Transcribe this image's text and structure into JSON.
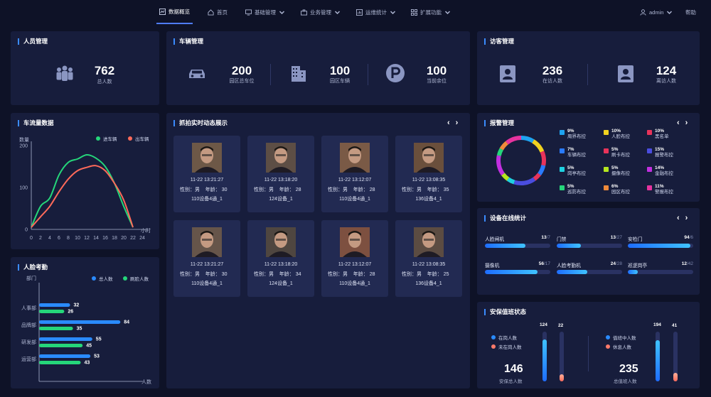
{
  "nav": {
    "items": [
      {
        "label": "数据概览",
        "active": true,
        "icon": "chart-icon"
      },
      {
        "label": "首页",
        "icon": "home-icon"
      },
      {
        "label": "基础管理",
        "icon": "monitor-icon",
        "dropdown": true
      },
      {
        "label": "业务管理",
        "icon": "briefcase-icon",
        "dropdown": true
      },
      {
        "label": "运维统计",
        "icon": "stats-icon",
        "dropdown": true
      },
      {
        "label": "扩展功能",
        "icon": "apps-icon",
        "dropdown": true
      }
    ],
    "user": "admin",
    "help": "帮助"
  },
  "personnel": {
    "title": "人员管理",
    "value": "762",
    "label": "总人数"
  },
  "vehicles": {
    "title": "车辆管理",
    "stats": [
      {
        "value": "200",
        "label": "园区总车位"
      },
      {
        "value": "100",
        "label": "园区车辆"
      },
      {
        "value": "100",
        "label": "当前余位"
      }
    ]
  },
  "visitors": {
    "title": "访客管理",
    "stats": [
      {
        "value": "236",
        "label": "在访人数"
      },
      {
        "value": "124",
        "label": "离访人数"
      }
    ]
  },
  "traffic": {
    "title": "车流量数据",
    "ylabel": "数量",
    "xunit": "小时",
    "legend_in": "进车辆",
    "legend_out": "出车辆"
  },
  "attendance": {
    "title": "人脸考勤",
    "ylabel": "部门",
    "xunit": "人数",
    "legend_total": "总人数",
    "legend_face": "刷脸人数"
  },
  "snapshots": {
    "title": "抓拍实时动态展示",
    "items": [
      {
        "time": "11-22 13:21:27",
        "gender_label": "性别：",
        "gender": "男",
        "age_label": "年龄：",
        "age": "30",
        "device": "110设备4通_1"
      },
      {
        "time": "11-22 13:18:20",
        "gender_label": "性别：",
        "gender": "男",
        "age_label": "年龄：",
        "age": "28",
        "device": "124设备_1"
      },
      {
        "time": "11-22 13:12:07",
        "gender_label": "性别：",
        "gender": "男",
        "age_label": "年龄：",
        "age": "28",
        "device": "110设备4通_1"
      },
      {
        "time": "11-22 13:08:35",
        "gender_label": "性别：",
        "gender": "男",
        "age_label": "年龄：",
        "age": "35",
        "device": "136设备4_1"
      },
      {
        "time": "11-22 13:21:27",
        "gender_label": "性别：",
        "gender": "男",
        "age_label": "年龄：",
        "age": "30",
        "device": "110设备4通_1"
      },
      {
        "time": "11-22 13:18:20",
        "gender_label": "性别：",
        "gender": "男",
        "age_label": "年龄：",
        "age": "34",
        "device": "124设备_1"
      },
      {
        "time": "11-22 13:12:07",
        "gender_label": "性别：",
        "gender": "男",
        "age_label": "年龄：",
        "age": "28",
        "device": "110设备4通_1"
      },
      {
        "time": "11-22 13:08:35",
        "gender_label": "性别：",
        "gender": "男",
        "age_label": "年龄：",
        "age": "25",
        "device": "136设备4_1"
      }
    ]
  },
  "alarms": {
    "title": "报警管理",
    "items": [
      {
        "pct": "9%",
        "name": "周界布控",
        "color": "#1fa3f0"
      },
      {
        "pct": "10%",
        "name": "人脸布控",
        "color": "#f0d21f"
      },
      {
        "pct": "10%",
        "name": "黑名单",
        "color": "#e8335a"
      },
      {
        "pct": "7%",
        "name": "车辆布控",
        "color": "#2a7bff"
      },
      {
        "pct": "5%",
        "name": "刷卡布控",
        "color": "#e8335a"
      },
      {
        "pct": "15%",
        "name": "报警布控",
        "color": "#4a4ddf"
      },
      {
        "pct": "5%",
        "name": "岗亭布控",
        "color": "#1fd0e0"
      },
      {
        "pct": "5%",
        "name": "摄像布控",
        "color": "#b5e61f"
      },
      {
        "pct": "14%",
        "name": "金融布控",
        "color": "#c22fe0"
      },
      {
        "pct": "5%",
        "name": "巡防布控",
        "color": "#25d67a"
      },
      {
        "pct": "6%",
        "name": "园区布控",
        "color": "#f08a3a"
      },
      {
        "pct": "11%",
        "name": "警报布控",
        "color": "#e6339f"
      }
    ]
  },
  "devices": {
    "title": "设备在线统计",
    "items": [
      {
        "name": "人脸闸机",
        "online": "13",
        "total": "/7",
        "level": 0.62
      },
      {
        "name": "门禁",
        "online": "13",
        "total": "/27",
        "level": 0.37
      },
      {
        "name": "安检门",
        "online": "94",
        "total": "/6",
        "level": 0.96
      },
      {
        "name": "摄像机",
        "online": "56",
        "total": "/17",
        "level": 0.8
      },
      {
        "name": "人脸考勤机",
        "online": "24",
        "total": "/28",
        "level": 0.47
      },
      {
        "name": "巡逻岗亭",
        "online": "12",
        "total": "/42",
        "level": 0.15
      }
    ]
  },
  "security": {
    "title": "安保值班状态",
    "left": {
      "legend1": "在岗人数",
      "legend2": "未在岗人数",
      "v1": "124",
      "v2": "22",
      "total": "146",
      "total_label": "安保总人数",
      "l1": 0.85,
      "l2": 0.15
    },
    "right": {
      "legend1": "值班中人数",
      "legend2": "休息人数",
      "v1": "194",
      "v2": "41",
      "total": "235",
      "total_label": "总值班人数",
      "l1": 0.83,
      "l2": 0.17
    }
  },
  "chart_data": [
    {
      "type": "line",
      "title": "车流量数据",
      "ylabel": "数量",
      "xlabel": "小时",
      "x": [
        0,
        2,
        4,
        6,
        8,
        10,
        12,
        14,
        16,
        18,
        20,
        22,
        24
      ],
      "ylim": [
        0,
        200
      ],
      "xticks": [
        "0",
        "2",
        "4",
        "6",
        "8",
        "10",
        "12",
        "14",
        "16",
        "18",
        "20",
        "22",
        "24"
      ],
      "yticks": [
        "0",
        "100",
        "200"
      ],
      "series": [
        {
          "name": "进车辆",
          "color": "#25d67a",
          "values": [
            5,
            55,
            75,
            130,
            160,
            168,
            178,
            170,
            150,
            110,
            55,
            5,
            null
          ]
        },
        {
          "name": "出车辆",
          "color": "#ff6a5a",
          "values": [
            5,
            30,
            55,
            90,
            120,
            140,
            148,
            152,
            140,
            110,
            70,
            5,
            null
          ]
        }
      ],
      "legend": "top-right"
    },
    {
      "type": "bar",
      "title": "人脸考勤",
      "categories": [
        "人事部",
        "品牌部",
        "研发部",
        "运营部"
      ],
      "series": [
        {
          "name": "总人数",
          "color": "#2a8bff",
          "values": [
            32,
            84,
            55,
            53
          ]
        },
        {
          "name": "刷脸人数",
          "color": "#25d67a",
          "values": [
            26,
            35,
            45,
            43
          ]
        }
      ],
      "xlabel": "人数",
      "ylabel": "部门",
      "xlim": [
        0,
        100
      ],
      "orientation": "horizontal"
    }
  ]
}
